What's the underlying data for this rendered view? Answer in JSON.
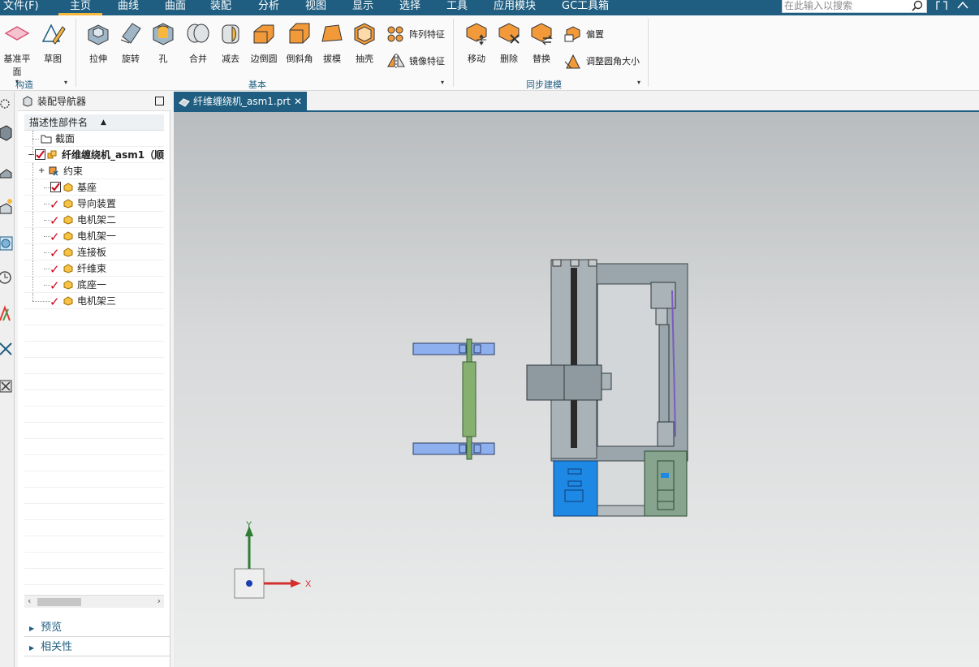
{
  "menubar": {
    "items": [
      "文件(F)",
      "主页",
      "曲线",
      "曲面",
      "装配",
      "分析",
      "视图",
      "显示",
      "选择",
      "工具",
      "应用模块",
      "GC工具箱"
    ],
    "active": "主页",
    "search_placeholder": "在此输入以搜索"
  },
  "ribbon": {
    "construct": {
      "label": "构造",
      "buttons": [
        "基准平面",
        "草图"
      ]
    },
    "basic": {
      "label": "基本",
      "buttons": [
        "拉伸",
        "旋转",
        "孔",
        "合并",
        "减去",
        "边倒圆",
        "倒斜角",
        "拔模",
        "抽壳"
      ],
      "small_buttons": [
        "阵列特征",
        "镜像特征"
      ]
    },
    "sync": {
      "label": "同步建模",
      "buttons": [
        "移动",
        "删除",
        "替换"
      ],
      "small_buttons": [
        "偏置",
        "调整圆角大小"
      ]
    }
  },
  "navigator": {
    "title": "装配导航器",
    "column_header": "描述性部件名",
    "rows": [
      {
        "label": "截面",
        "kind": "folder"
      },
      {
        "label": "纤维缠绕机_asm1（顺",
        "kind": "assembly"
      },
      {
        "label": "约束",
        "kind": "constraint"
      },
      {
        "label": "基座",
        "kind": "part-boxed"
      },
      {
        "label": "导向装置",
        "kind": "part"
      },
      {
        "label": "电机架二",
        "kind": "part"
      },
      {
        "label": "电机架一",
        "kind": "part"
      },
      {
        "label": "连接板",
        "kind": "part"
      },
      {
        "label": "纤维束",
        "kind": "part"
      },
      {
        "label": "底座一",
        "kind": "part"
      },
      {
        "label": "电机架三",
        "kind": "part"
      }
    ],
    "sections": [
      "预览",
      "相关性"
    ]
  },
  "document": {
    "tab_label": "纤维缠绕机_asm1.prt",
    "close": "✕"
  },
  "triad": {
    "x_label": "X",
    "y_label": "Y"
  },
  "colors": {
    "brand": "#1f5e80",
    "accent": "#f6b73c",
    "tick": "#d0021b",
    "part_blue": "#1e88e5",
    "part_green": "#7aa66a"
  }
}
